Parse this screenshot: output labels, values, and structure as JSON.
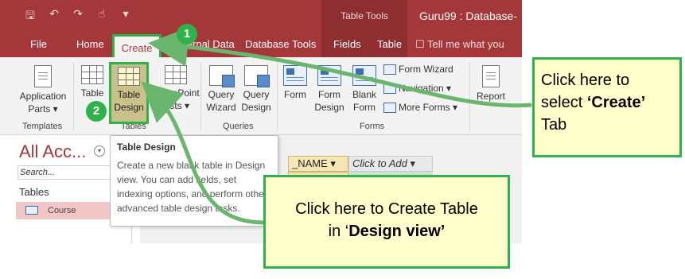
{
  "window": {
    "context_header": "Table Tools",
    "document_title": "Guru99 : Database-"
  },
  "qat_icons": [
    "save-icon",
    "undo-icon",
    "redo-icon",
    "touch-mode-icon",
    "customize-icon"
  ],
  "tabs": [
    {
      "label": "File"
    },
    {
      "label": "Home"
    },
    {
      "label": "Create"
    },
    {
      "label": "External Data"
    },
    {
      "label": "Database Tools"
    },
    {
      "label": "Fields"
    },
    {
      "label": "Table"
    }
  ],
  "tell_me": "Tell me what you",
  "ribbon": {
    "templates": {
      "label": "Templates",
      "app_parts": [
        "Application",
        "Parts ▾"
      ]
    },
    "tables": {
      "label": "Tables",
      "table": "Table",
      "table_design": [
        "Table",
        "Design"
      ],
      "sharepoint": [
        "SharePoint",
        "Lists ▾"
      ]
    },
    "queries": {
      "label": "Queries",
      "wizard": [
        "Query",
        "Wizard"
      ],
      "design": [
        "Query",
        "Design"
      ]
    },
    "forms": {
      "label": "Forms",
      "form": "Form",
      "form_design": [
        "Form",
        "Design"
      ],
      "blank_form": [
        "Blank",
        "Form"
      ],
      "form_wizard": "Form Wizard",
      "navigation": "Navigation ▾",
      "more_forms": "More Forms ▾"
    },
    "reports": {
      "report": "Report"
    }
  },
  "nav_pane": {
    "title": "All Acc...",
    "search_placeholder": "Search...",
    "group": "Tables",
    "items": [
      {
        "label": "Course"
      }
    ]
  },
  "datasheet": {
    "columns": [
      "_NAME ▾",
      "Click to Add ▾"
    ]
  },
  "tooltip": {
    "title": "Table Design",
    "body": "Create a new blank table in Design view. You can add fields, set indexing options, and perform other advanced table design tasks."
  },
  "callouts": {
    "one": {
      "line1": "Click here to",
      "line2_pre": "select ",
      "line2_bold": "‘Create’",
      "line3": "Tab",
      "badge": "1"
    },
    "two": {
      "line1": "Click here to Create Table",
      "line2_pre": "in ‘",
      "line2_bold": "Design view’",
      "badge": "2"
    }
  },
  "colors": {
    "access_red": "#a4373a",
    "callout_green": "#2fb24a",
    "callout_fill": "#ffffcc"
  }
}
